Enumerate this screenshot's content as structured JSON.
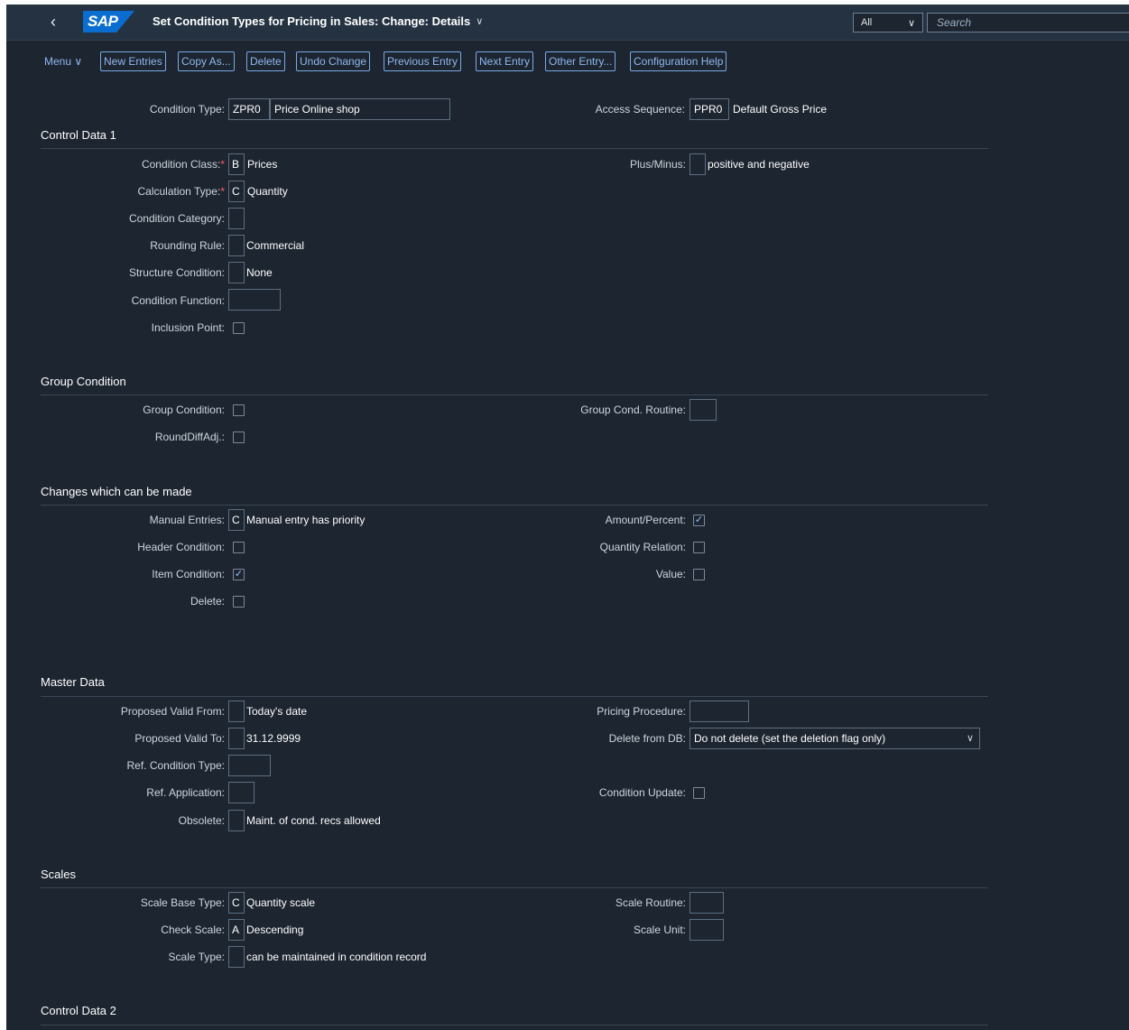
{
  "shell": {
    "title": "Set Condition Types for Pricing in Sales: Change: Details",
    "scope": "All",
    "search_placeholder": "Search"
  },
  "toolbar": {
    "menu": "Menu",
    "buttons": [
      "New Entries",
      "Copy As...",
      "Delete",
      "Undo Change",
      "Previous Entry",
      "Next Entry",
      "Other Entry...",
      "Configuration Help"
    ]
  },
  "header": {
    "condition_type_label": "Condition Type:",
    "condition_type_code": "ZPR0",
    "condition_type_text": "Price Online shop",
    "access_sequence_label": "Access Sequence:",
    "access_sequence_code": "PPR0",
    "access_sequence_text": "Default Gross Price"
  },
  "control1": {
    "title": "Control Data 1",
    "condition_class_label": "Condition Class:",
    "condition_class_code": "B",
    "condition_class_text": "Prices",
    "calc_type_label": "Calculation Type:",
    "calc_type_code": "C",
    "calc_type_text": "Quantity",
    "cond_category_label": "Condition Category:",
    "rounding_rule_label": "Rounding Rule:",
    "rounding_rule_text": "Commercial",
    "structure_cond_label": "Structure Condition:",
    "structure_cond_text": "None",
    "cond_function_label": "Condition Function:",
    "inclusion_point_label": "Inclusion Point:",
    "plus_minus_label": "Plus/Minus:",
    "plus_minus_text": "positive and negative"
  },
  "group": {
    "title": "Group Condition",
    "group_condition_label": "Group Condition:",
    "round_diff_label": "RoundDiffAdj.:",
    "group_routine_label": "Group Cond. Routine:"
  },
  "changes": {
    "title": "Changes which can be made",
    "manual_entries_label": "Manual Entries:",
    "manual_entries_code": "C",
    "manual_entries_text": "Manual entry has priority",
    "header_condition_label": "Header Condition:",
    "item_condition_label": "Item Condition:",
    "delete_label": "Delete:",
    "amount_percent_label": "Amount/Percent:",
    "quantity_relation_label": "Quantity Relation:",
    "value_label": "Value:",
    "checked_mark": "✓"
  },
  "master": {
    "title": "Master Data",
    "valid_from_label": "Proposed Valid From:",
    "valid_from_text": "Today's date",
    "valid_to_label": "Proposed Valid To:",
    "valid_to_text": "31.12.9999",
    "ref_cond_type_label": "Ref. Condition Type:",
    "ref_application_label": "Ref. Application:",
    "obsolete_label": "Obsolete:",
    "obsolete_text": "Maint. of cond. recs allowed",
    "pricing_procedure_label": "Pricing Procedure:",
    "delete_from_db_label": "Delete from DB:",
    "delete_from_db_value": "Do not delete (set the deletion flag only)",
    "condition_update_label": "Condition Update:"
  },
  "scales": {
    "title": "Scales",
    "scale_base_type_label": "Scale Base Type:",
    "scale_base_type_code": "C",
    "scale_base_type_text": "Quantity scale",
    "check_scale_label": "Check Scale:",
    "check_scale_code": "A",
    "check_scale_text": "Descending",
    "scale_type_label": "Scale Type:",
    "scale_type_text": "can be maintained in condition record",
    "scale_routine_label": "Scale Routine:",
    "scale_unit_label": "Scale Unit:"
  },
  "control2": {
    "title": "Control Data 2"
  }
}
